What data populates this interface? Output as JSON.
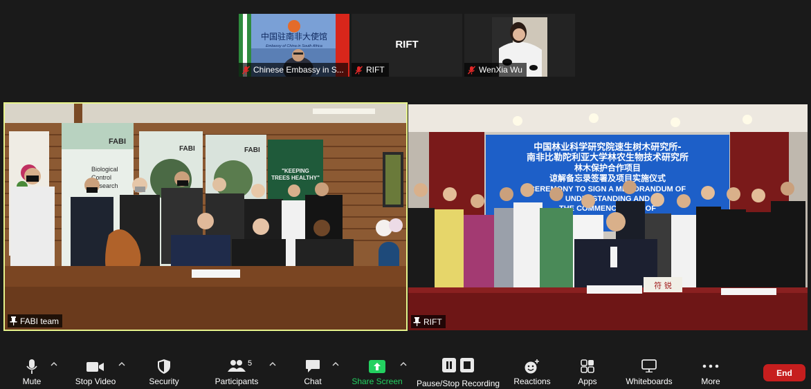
{
  "participants_strip": [
    {
      "name": "Chinese Embassy in S...",
      "muted": true
    },
    {
      "name": "RIFT",
      "center_text": "RIFT",
      "muted": true
    },
    {
      "name": "WenXia Wu",
      "muted": true
    }
  ],
  "embassy_video": {
    "banner_cn": "中国驻南非大使馆",
    "banner_en": "Embassy of China in South Africa"
  },
  "main_tiles": [
    {
      "name": "FABI team",
      "pinned": true,
      "active_speaker": true,
      "poster_texts": [
        "FABI",
        "Biological Control Research FABI",
        "FABI",
        "FABI",
        "KEEPING TREES HEALTHY"
      ]
    },
    {
      "name": "RIFT",
      "pinned": true,
      "active_speaker": false,
      "banner_lines": [
        "中国林业科学研究院速生树木研究所-",
        "南非比勒陀利亚大学林农生物技术研究所",
        "林木保护合作项目",
        "谅解备忘录签署及项目实施仪式",
        "CEREMONY TO SIGN A MEMORANDUM OF",
        "UNDERSTANDING AND",
        "THE COMMENCEMENT OF"
      ],
      "nameplate": "符 锐"
    }
  ],
  "toolbar": {
    "mute": "Mute",
    "stop_video": "Stop Video",
    "security": "Security",
    "participants": "Participants",
    "participants_count": "5",
    "chat": "Chat",
    "share_screen": "Share Screen",
    "recording": "Pause/Stop Recording",
    "reactions": "Reactions",
    "apps": "Apps",
    "whiteboards": "Whiteboards",
    "more": "More",
    "end": "End"
  },
  "colors": {
    "active_speaker_border": "#e8f48c",
    "share_green": "#23d160",
    "end_red": "#c61e1e"
  }
}
